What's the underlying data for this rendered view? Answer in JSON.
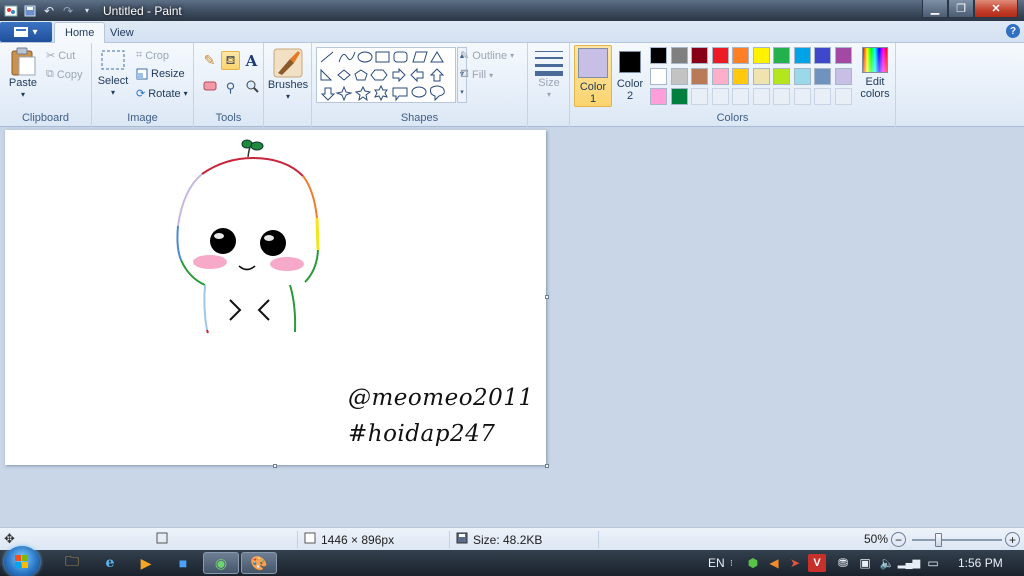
{
  "window": {
    "title": "Untitled - Paint",
    "controls": [
      "minimize",
      "restore",
      "close"
    ]
  },
  "tabs": [
    {
      "label": "Home"
    },
    {
      "label": "View"
    }
  ],
  "ribbon": {
    "clipboard": {
      "label": "Clipboard",
      "paste": "Paste",
      "cut": "Cut",
      "copy": "Copy"
    },
    "image": {
      "label": "Image",
      "select": "Select",
      "crop": "Crop",
      "resize": "Resize",
      "rotate": "Rotate"
    },
    "tools": {
      "label": "Tools"
    },
    "brushes": {
      "label": "Brushes"
    },
    "shapes": {
      "label": "Shapes",
      "outline": "Outline",
      "fill": "Fill",
      "size": "Size"
    },
    "colors": {
      "label": "Colors",
      "color1": "Color 1",
      "color1_value": "#c8bfe7",
      "color2": "Color 2",
      "color2_value": "#000000",
      "edit": "Edit colors",
      "palette_row1": [
        "#000000",
        "#7f7f7f",
        "#880015",
        "#ed1c24",
        "#ff7f27",
        "#fff200",
        "#22b14c",
        "#00a2e8",
        "#3f48cc",
        "#a349a4"
      ],
      "palette_row2": [
        "#ffffff",
        "#c3c3c3",
        "#b97a57",
        "#ffaec9",
        "#ffc90e",
        "#efe4b0",
        "#b5e61d",
        "#99d9ea",
        "#7092be",
        "#c8bfe7"
      ],
      "palette_row3": [
        "#ff9ed8",
        "#007f3f"
      ]
    }
  },
  "canvas": {
    "text_line1": "@meomeo2011",
    "text_line2": "#hoidap247"
  },
  "status": {
    "dimensions": "1446 × 896px",
    "size": "Size: 48.2KB",
    "zoom": "50%",
    "zoom_level": 0.5
  },
  "taskbar": {
    "lang": "EN",
    "time": "1:56 PM"
  }
}
